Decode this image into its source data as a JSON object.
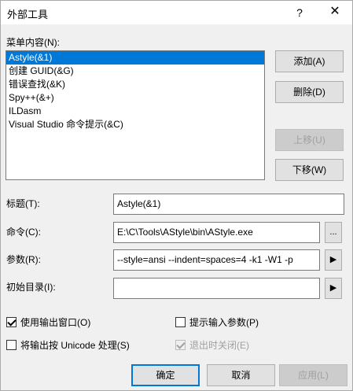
{
  "window": {
    "title": "外部工具",
    "help_glyph": "?",
    "close_glyph": "✕"
  },
  "menu_contents_label": "菜单内容(N):",
  "menu_items": [
    {
      "label": "Astyle(&1)",
      "selected": true
    },
    {
      "label": "创建 GUID(&G)",
      "selected": false
    },
    {
      "label": "错误查找(&K)",
      "selected": false
    },
    {
      "label": "Spy++(&+)",
      "selected": false
    },
    {
      "label": "ILDasm",
      "selected": false
    },
    {
      "label": "Visual Studio 命令提示(&C)",
      "selected": false
    }
  ],
  "buttons": {
    "add": "添加(A)",
    "delete": "删除(D)",
    "move_up": "上移(U)",
    "move_down": "下移(W)",
    "ok": "确定",
    "cancel": "取消",
    "apply": "应用(L)"
  },
  "fields": {
    "title": {
      "label": "标题(T):",
      "value": "Astyle(&1)"
    },
    "command": {
      "label": "命令(C):",
      "value": "E:\\C\\Tools\\AStyle\\bin\\AStyle.exe",
      "browse": "..."
    },
    "arguments": {
      "label": "参数(R):",
      "value": "--style=ansi --indent=spaces=4  -k1 -W1 -p",
      "arrow": "▶"
    },
    "initial_dir": {
      "label": "初始目录(I):",
      "value": "",
      "arrow": "▶"
    }
  },
  "checkboxes": {
    "use_output_window": {
      "label": "使用输出窗口(O)",
      "checked": true
    },
    "prompt_arguments": {
      "label": "提示输入参数(P)",
      "checked": false
    },
    "treat_unicode": {
      "label": "将输出按 Unicode 处理(S)",
      "checked": false
    },
    "close_on_exit": {
      "label": "退出时关闭(E)",
      "checked": true
    }
  }
}
